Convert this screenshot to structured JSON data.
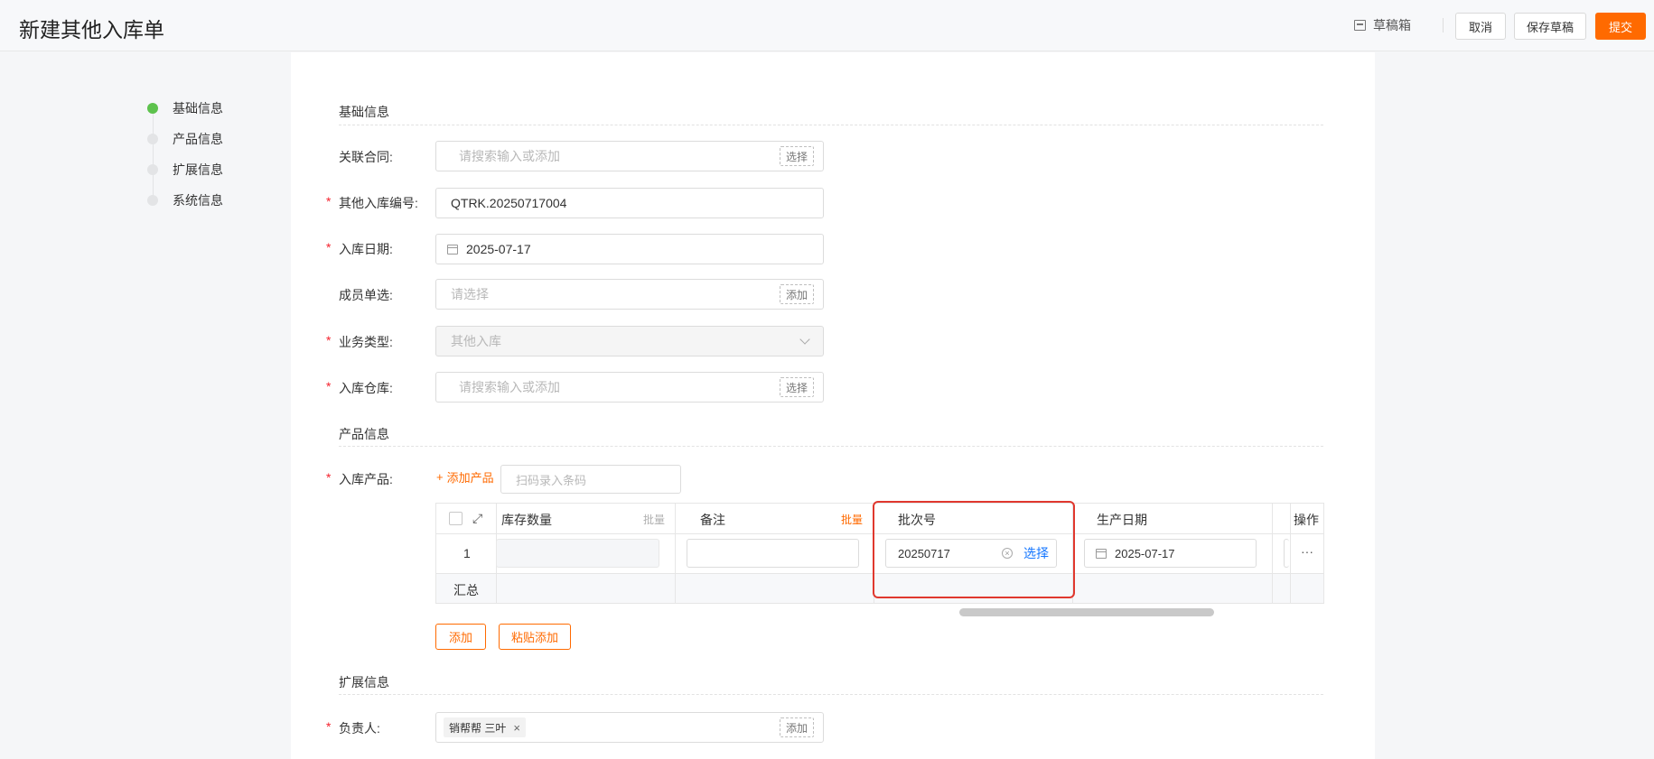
{
  "header": {
    "title": "新建其他入库单",
    "drafts_label": "草稿箱",
    "cancel_label": "取消",
    "save_draft_label": "保存草稿",
    "submit_label": "提交"
  },
  "steps": [
    {
      "label": "基础信息",
      "active": true
    },
    {
      "label": "产品信息",
      "active": false
    },
    {
      "label": "扩展信息",
      "active": false
    },
    {
      "label": "系统信息",
      "active": false
    }
  ],
  "sections": {
    "basic": "基础信息",
    "product": "产品信息",
    "extend": "扩展信息"
  },
  "form": {
    "contract": {
      "label": "关联合同:",
      "placeholder": "请搜索输入或添加",
      "button": "选择"
    },
    "number": {
      "label": "其他入库编号:",
      "value": "QTRK.20250717004"
    },
    "date": {
      "label": "入库日期:",
      "value": "2025-07-17"
    },
    "member": {
      "label": "成员单选:",
      "placeholder": "请选择",
      "button": "添加"
    },
    "biz_type": {
      "label": "业务类型:",
      "value": "其他入库"
    },
    "warehouse": {
      "label": "入库仓库:",
      "placeholder": "请搜索输入或添加",
      "button": "选择"
    },
    "products": {
      "label": "入库产品:",
      "add_label": "添加产品",
      "scan_placeholder": "扫码录入条码"
    },
    "owner": {
      "label": "负责人:",
      "tag": "销帮帮 三叶",
      "button": "添加"
    }
  },
  "required_mark": "*",
  "table": {
    "headers": {
      "stock_qty": "库存数量",
      "remark": "备注",
      "batch_no": "批次号",
      "prod_date": "生产日期",
      "action": "操作"
    },
    "batch_label": "批量",
    "rows": [
      {
        "index": "1",
        "batch_no": "20250717",
        "select_label": "选择",
        "prod_date": "2025-07-17",
        "more": "···"
      }
    ],
    "summary_label": "汇总"
  },
  "buttons": {
    "add": "添加",
    "paste_add": "粘贴添加"
  },
  "colors": {
    "accent": "#ff6a00",
    "link": "#1677ff",
    "highlight": "#e0382e",
    "step_active": "#5dc24d"
  }
}
